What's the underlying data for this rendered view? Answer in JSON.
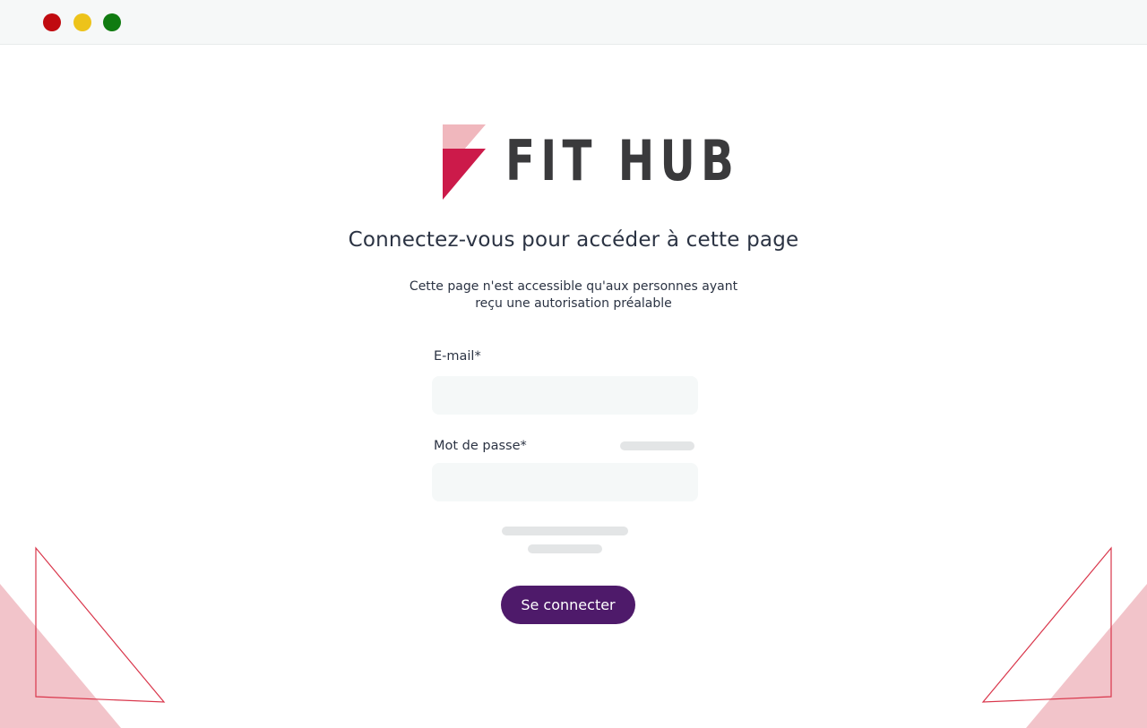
{
  "window": {
    "controls": [
      "close",
      "minimize",
      "maximize"
    ]
  },
  "brand": {
    "name": "FIT HUB",
    "accent": "#cc1a4a",
    "accent_light": "#f0b7bd"
  },
  "main": {
    "title": "Connectez-vous pour accéder à cette page",
    "description": "Cette page n'est accessible qu'aux personnes ayant reçu une autorisation préalable"
  },
  "form": {
    "email": {
      "label": "E-mail*",
      "value": "",
      "placeholder": ""
    },
    "password": {
      "label": "Mot de passe*",
      "value": "",
      "placeholder": ""
    },
    "submit_label": "Se connecter"
  },
  "colors": {
    "button": "#4e1a6a",
    "decoration": "#f2c4ca",
    "decoration_line": "#d9364b"
  }
}
